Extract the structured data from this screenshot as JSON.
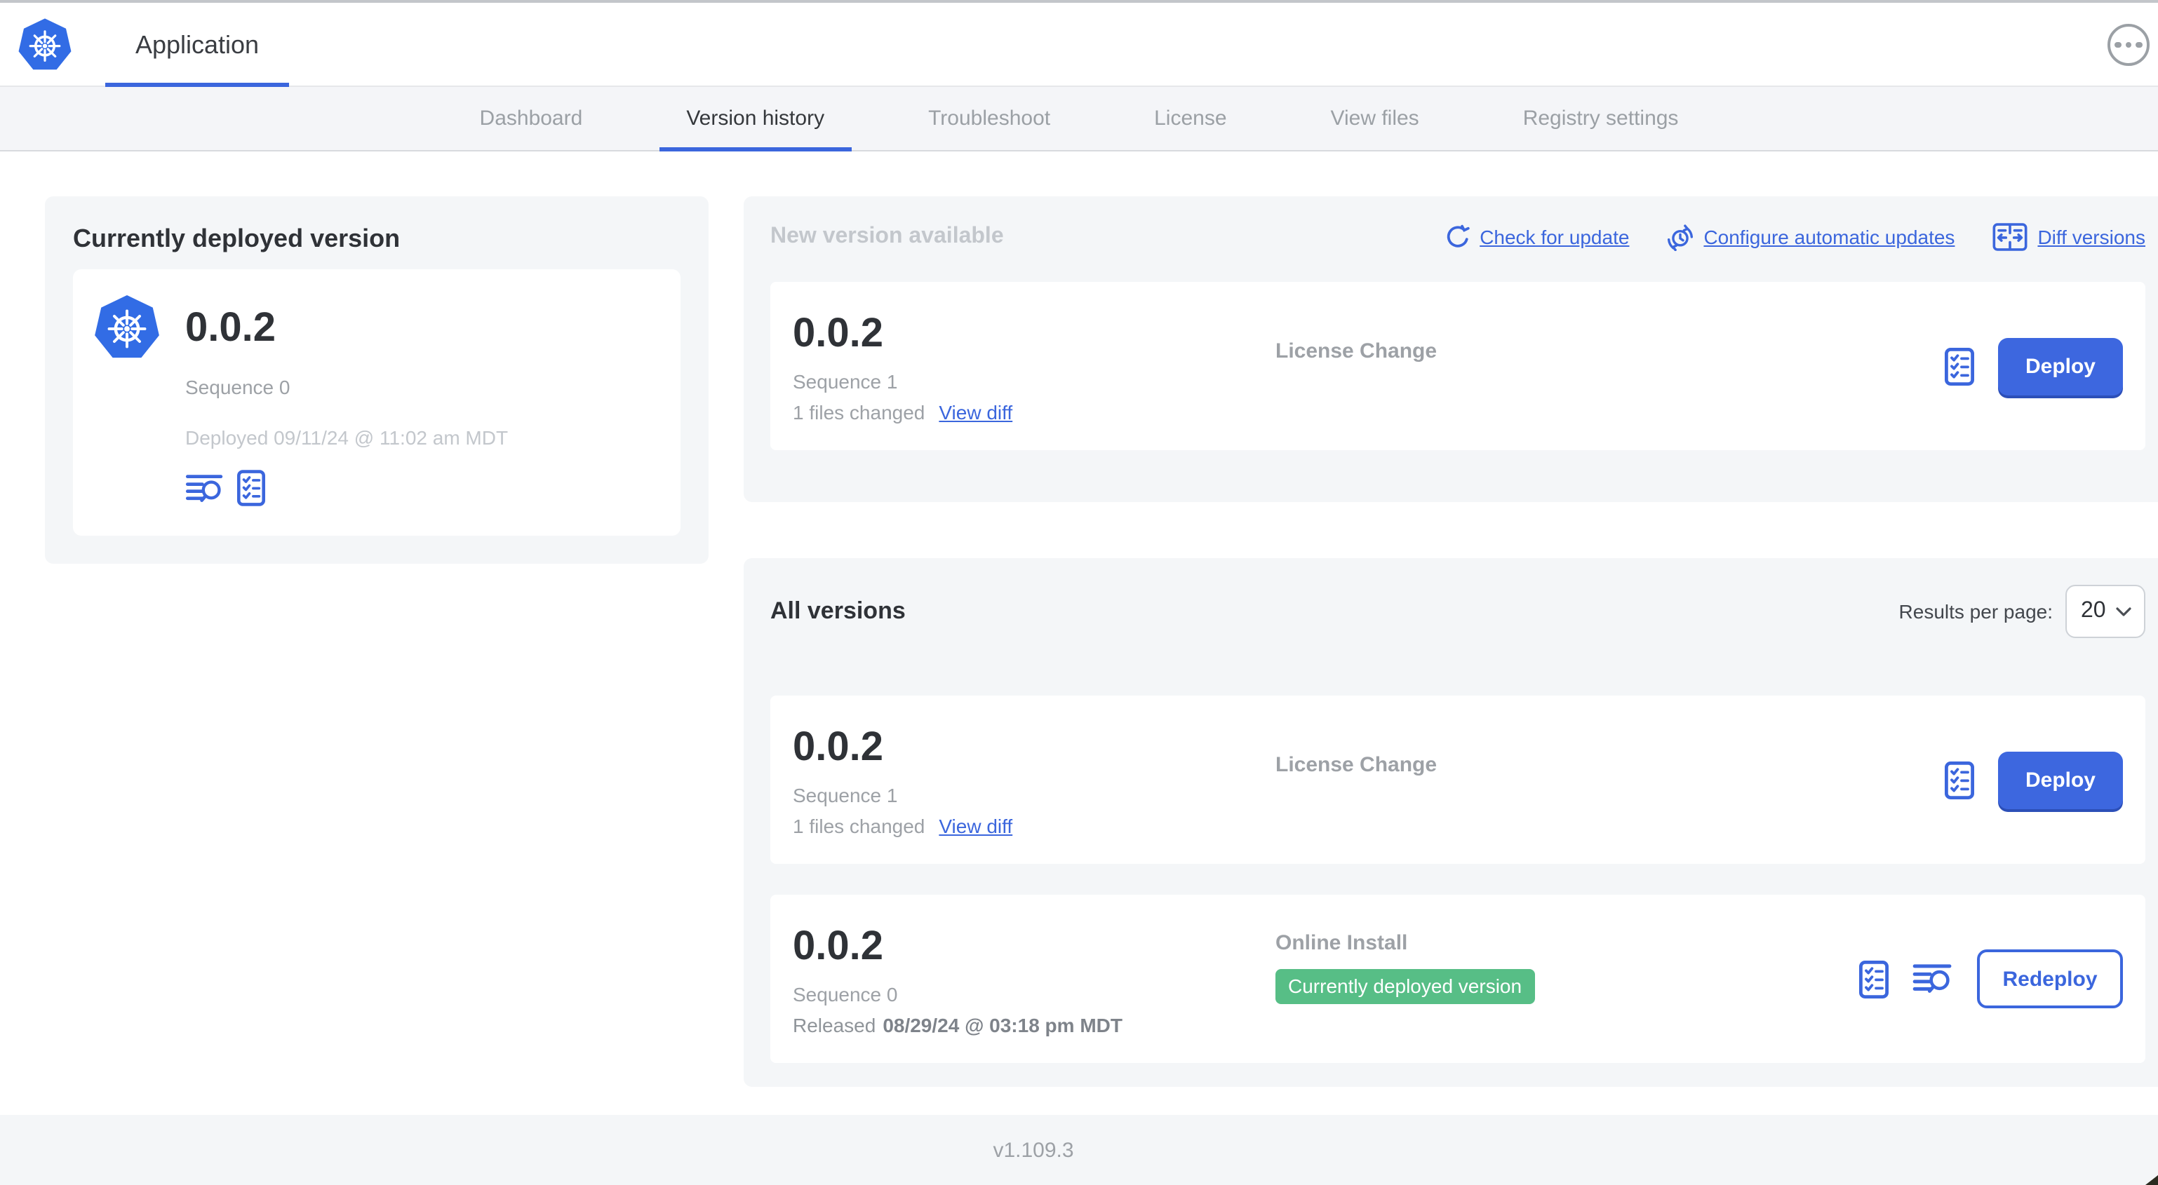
{
  "header": {
    "app_title": "Application"
  },
  "nav": {
    "tabs": [
      {
        "label": "Dashboard",
        "active": false
      },
      {
        "label": "Version history",
        "active": true
      },
      {
        "label": "Troubleshoot",
        "active": false
      },
      {
        "label": "License",
        "active": false
      },
      {
        "label": "View files",
        "active": false
      },
      {
        "label": "Registry settings",
        "active": false
      }
    ]
  },
  "current_version": {
    "title": "Currently deployed version",
    "version": "0.0.2",
    "sequence": "Sequence 0",
    "deployed": "Deployed 09/11/24 @ 11:02 am MDT"
  },
  "new_version": {
    "title": "New version available",
    "actions": [
      {
        "label": "Check for update",
        "icon": "refresh-icon"
      },
      {
        "label": "Configure automatic updates",
        "icon": "schedule-icon"
      },
      {
        "label": "Diff versions",
        "icon": "diff-icon"
      }
    ],
    "row": {
      "version": "0.0.2",
      "sequence": "Sequence 1",
      "files_changed": "1 files changed",
      "view_diff_label": "View diff",
      "source": "License Change",
      "action_label": "Deploy"
    }
  },
  "all_versions": {
    "title": "All versions",
    "results_per_page_label": "Results per page:",
    "results_per_page_value": "20",
    "rows": [
      {
        "version": "0.0.2",
        "sequence": "Sequence 1",
        "files_changed": "1 files changed",
        "view_diff_label": "View diff",
        "source": "License Change",
        "action_label": "Deploy"
      },
      {
        "version": "0.0.2",
        "sequence": "Sequence 0",
        "released_prefix": "Released",
        "released_date": "08/29/24 @ 03:18 pm MDT",
        "source": "Online Install",
        "badge": "Currently deployed version",
        "action_label": "Redeploy"
      }
    ]
  },
  "footer": {
    "app_manager_version": "v1.109.3"
  },
  "colors": {
    "accent_blue": "#3B66DD",
    "kubernetes_blue": "#326CE5",
    "success_green": "#57BE86",
    "panel_gray": "#F4F6F8"
  }
}
